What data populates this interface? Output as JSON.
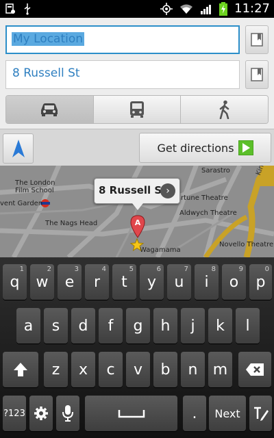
{
  "status": {
    "time": "11:27",
    "icons": [
      "debug-icon",
      "usb-icon",
      "gps-icon",
      "wifi-icon",
      "signal-icon",
      "battery-charging-icon"
    ]
  },
  "directions": {
    "from_value": "My Location",
    "to_value": "8 Russell St",
    "modes": [
      {
        "name": "car-icon",
        "active": true
      },
      {
        "name": "bus-icon",
        "active": false
      },
      {
        "name": "walk-icon",
        "active": false
      }
    ],
    "get_directions_label": "Get directions"
  },
  "map": {
    "labels": {
      "london_film_school": "The London\nFilm School",
      "covent_garden": "vent Garden",
      "nags_head": "The Nags Head",
      "sarastro": "Sarastro",
      "fortune_theatre": "rtune Theatre",
      "aldwych_theatre": "Aldwych Theatre",
      "novello_theatre": "Novello Theatre",
      "wagamama": "Wagamama",
      "kingsway": "Kingsway"
    },
    "callout_title": "8 Russell St",
    "marker_letter": "A"
  },
  "keyboard": {
    "row1": [
      {
        "k": "q",
        "h": "1"
      },
      {
        "k": "w",
        "h": "2"
      },
      {
        "k": "e",
        "h": "3"
      },
      {
        "k": "r",
        "h": "4"
      },
      {
        "k": "t",
        "h": "5"
      },
      {
        "k": "y",
        "h": "6"
      },
      {
        "k": "u",
        "h": "7"
      },
      {
        "k": "i",
        "h": "8"
      },
      {
        "k": "o",
        "h": "9"
      },
      {
        "k": "p",
        "h": "0"
      }
    ],
    "row2": [
      "a",
      "s",
      "d",
      "f",
      "g",
      "h",
      "j",
      "k",
      "l"
    ],
    "row3": [
      "z",
      "x",
      "c",
      "v",
      "b",
      "n",
      "m"
    ],
    "symbols_label": "?123",
    "next_label": "Next",
    "period_label": "."
  }
}
